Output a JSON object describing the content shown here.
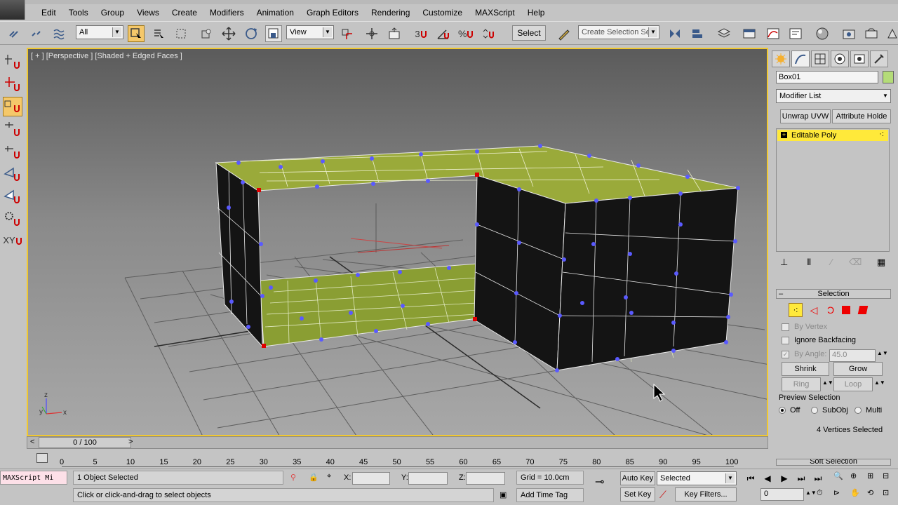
{
  "menu": [
    "Edit",
    "Tools",
    "Group",
    "Views",
    "Create",
    "Modifiers",
    "Animation",
    "Graph Editors",
    "Rendering",
    "Customize",
    "MAXScript",
    "Help"
  ],
  "toolbar": {
    "filter_value": "All",
    "refcoord_value": "View",
    "select_label": "Select",
    "named_selection_placeholder": "Create Selection Sel",
    "snap_number": "3"
  },
  "left_toolbar": [
    "create-icon",
    "move-icon",
    "magnet-icon",
    "axis-icon",
    "tool-icon",
    "rotate-icon",
    "gear-icon",
    "xy-icon"
  ],
  "left_toolbar_text": {
    "xy": "XY"
  },
  "viewport": {
    "label": "[ + ] [Perspective ] [Shaded + Edged Faces ]",
    "axis_x": "x",
    "axis_y": "y",
    "axis_z": "z"
  },
  "command_panel": {
    "object_name": "Box01",
    "object_color": "#b4dc78",
    "modifier_list": "Modifier List",
    "btn_unwrap": "Unwrap UVW",
    "btn_attribute": "Attribute Holde",
    "stack_item": "Editable Poly",
    "selection": {
      "title": "Selection",
      "by_vertex": "By Vertex",
      "ignore_backfacing": "Ignore Backfacing",
      "by_angle": "By Angle:",
      "angle_value": "45.0",
      "shrink": "Shrink",
      "grow": "Grow",
      "ring": "Ring",
      "loop": "Loop",
      "preview_selection": "Preview Selection",
      "off": "Off",
      "subobj": "SubObj",
      "multi": "Multi",
      "status": "4 Vertices Selected"
    },
    "soft_selection_partial": "Soft Selection"
  },
  "timeline": {
    "frame": "0 / 100",
    "ticks": [
      "0",
      "5",
      "10",
      "15",
      "20",
      "25",
      "30",
      "35",
      "40",
      "45",
      "50",
      "55",
      "60",
      "65",
      "70",
      "75",
      "80",
      "85",
      "90",
      "95",
      "100"
    ]
  },
  "status": {
    "listener": "MAXScript Mi",
    "objects_selected": "1 Object Selected",
    "prompt": "Click or click-and-drag to select objects",
    "x_label": "X:",
    "y_label": "Y:",
    "z_label": "Z:",
    "grid": "Grid = 10.0cm",
    "add_time_tag": "Add Time Tag",
    "auto_key": "Auto Key",
    "set_key": "Set Key",
    "key_mode": "Selected",
    "key_filters": "Key Filters...",
    "frame_field": "0"
  }
}
